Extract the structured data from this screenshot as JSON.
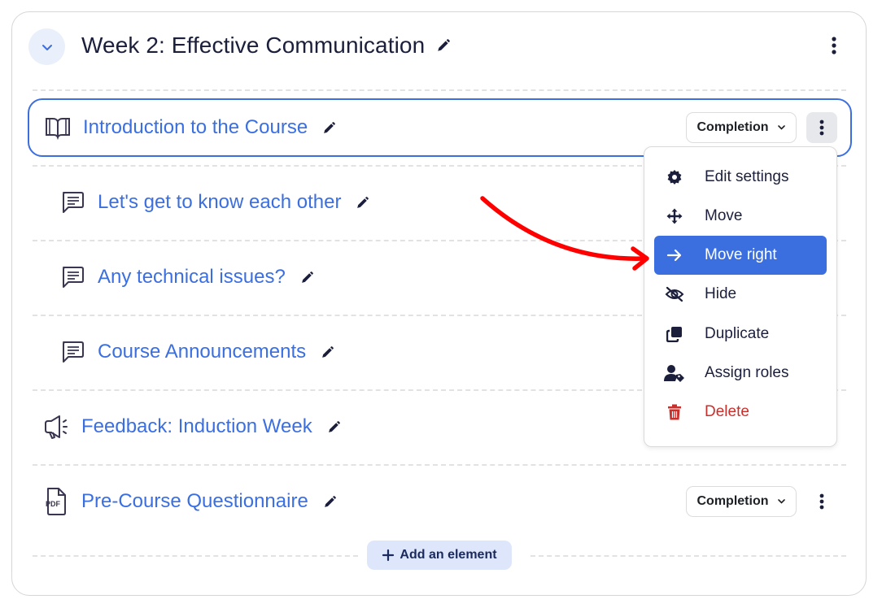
{
  "section": {
    "title": "Week 2: Effective Communication",
    "collapse_icon": "chevron-down-icon",
    "edit_icon": "pencil-icon",
    "menu_icon": "kebab-vertical-icon"
  },
  "activities": [
    {
      "title": "Introduction to the Course",
      "icon": "book-open-icon",
      "indent": false,
      "selected": true,
      "completion": "Completion",
      "menu_open": true
    },
    {
      "title": "Let's get to know each other",
      "icon": "forum-chat-icon",
      "indent": true
    },
    {
      "title": "Any technical issues?",
      "icon": "forum-chat-icon",
      "indent": true
    },
    {
      "title": "Course Announcements",
      "icon": "forum-chat-icon",
      "indent": true
    },
    {
      "title": "Feedback: Induction Week",
      "icon": "megaphone-feedback-icon",
      "indent": false
    },
    {
      "title": "Pre-Course Questionnaire",
      "icon": "pdf-file-icon",
      "indent": false,
      "completion": "Completion"
    }
  ],
  "pdf_icon_label": "PDF",
  "action_menu": {
    "items": [
      {
        "label": "Edit settings",
        "icon": "gear-icon"
      },
      {
        "label": "Move",
        "icon": "move-arrows-icon"
      },
      {
        "label": "Move right",
        "icon": "arrow-right-icon",
        "highlighted": true
      },
      {
        "label": "Hide",
        "icon": "eye-slash-icon"
      },
      {
        "label": "Duplicate",
        "icon": "duplicate-icon"
      },
      {
        "label": "Assign roles",
        "icon": "user-tag-icon"
      },
      {
        "label": "Delete",
        "icon": "trash-icon",
        "danger": true
      }
    ]
  },
  "add_element": {
    "label": "Add an element",
    "icon": "plus-icon"
  },
  "annotation": {
    "type": "curved-arrow",
    "color": "#ff0000",
    "points_to": "Move right"
  },
  "colors": {
    "accent": "#3b6fe0",
    "title_text": "#1b1f3b",
    "danger": "#c9302c",
    "add_button_bg": "#dde6fb",
    "collapse_bg": "#e9effb"
  }
}
